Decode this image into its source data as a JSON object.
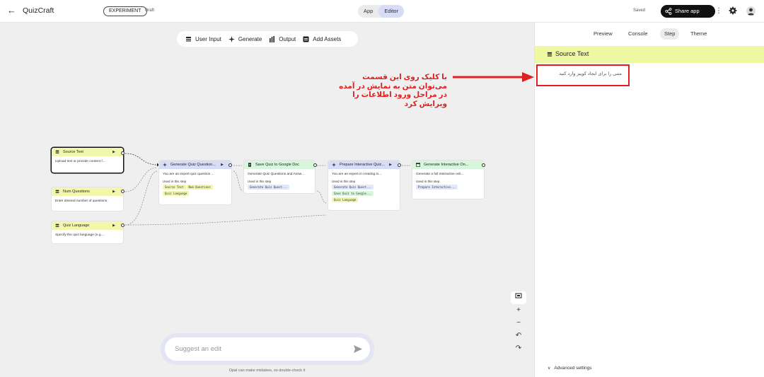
{
  "header": {
    "back_label": "←",
    "app_title": "QuizCraft",
    "experiment_badge": "EXPERIMENT",
    "status": "Draft",
    "mode_tabs": [
      "App",
      "Editor"
    ],
    "active_mode": "Editor",
    "saved_status": "Saved",
    "share_label": "Share app"
  },
  "toolbar": {
    "items": [
      {
        "label": "User Input",
        "icon": "user-input-icon"
      },
      {
        "label": "Generate",
        "icon": "sparkle-icon"
      },
      {
        "label": "Output",
        "icon": "output-icon"
      },
      {
        "label": "Add Assets",
        "icon": "assets-icon"
      }
    ]
  },
  "annotation": {
    "text_lines": [
      "با کلیک روی این قسمت",
      "می‌توان متن به نمایش در آمده",
      "در مراحل ورود اطلاعات را",
      "ویرایش کرد"
    ],
    "color": "#e02020"
  },
  "nodes": [
    {
      "id": "source-text",
      "title": "Source Text",
      "body": "Upload text or provide content f...",
      "color": "#f1f8ad"
    },
    {
      "id": "num-questions",
      "title": "Num Questions",
      "body": "Enter desired number of questions.",
      "color": "#f1f8ad"
    },
    {
      "id": "quiz-language",
      "title": "Quiz Language",
      "body": "Specify the quiz language (e.g....",
      "color": "#f1f8ad"
    },
    {
      "id": "generate-quiz",
      "title": "Generate Quiz Question...",
      "body": "You are an expert quiz question ...",
      "used_label": "Used in this step",
      "chips": [
        "Source Text",
        "Num Questions",
        "Quiz Language"
      ],
      "color": "#d7ddf7"
    },
    {
      "id": "save-quiz",
      "title": "Save Quiz to Google Doc",
      "body": "Generate Quiz Questions and Answ...",
      "used_label": "Used in this step",
      "chips": [
        "Generate Quiz Quest..."
      ],
      "color": "#d7f6dc"
    },
    {
      "id": "prepare-quiz",
      "title": "Prepare Interactive Quiz...",
      "body": "You are an expert in creating in...",
      "used_label": "Used in this step",
      "chips": [
        "Generate Quiz Quest...",
        "Save Quiz to Google...",
        "Quiz Language"
      ],
      "color": "#d7ddf7"
    },
    {
      "id": "generate-interactive",
      "title": "Generate Interactive On...",
      "body": "Generate a full interactive onli...",
      "used_label": "Used in this step",
      "chips": [
        "Prepare Interactive..."
      ],
      "color": "#d7f6dc"
    }
  ],
  "zoom_controls": [
    "+",
    "−",
    "↶",
    "↷"
  ],
  "suggest": {
    "placeholder": "Suggest an edit",
    "disclaimer": "Opal can make mistakes, so double-check it"
  },
  "panel": {
    "tabs": [
      "Preview",
      "Console",
      "Step",
      "Theme"
    ],
    "active_tab": "Step",
    "step_title": "Source Text",
    "prompt_text": "متنی را برای ایجاد کوییز وارد کنید",
    "advanced_label": "Advanced settings"
  }
}
